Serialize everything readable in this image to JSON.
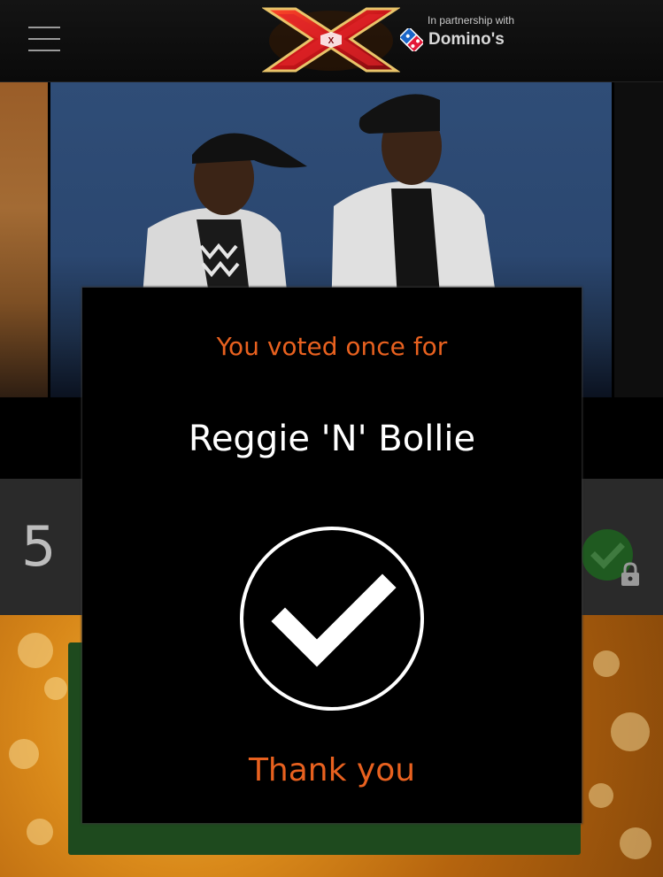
{
  "header": {
    "partner_label": "In partnership with",
    "partner_name": "Domino's",
    "logo_icon": "x-factor-logo",
    "menu_icon": "hamburger-menu-icon"
  },
  "contestant_row": {
    "rank": "5"
  },
  "modal": {
    "subtitle": "You voted once for",
    "name": "Reggie 'N' Bollie",
    "check_icon": "check-circle-icon",
    "thanks": "Thank you"
  },
  "colors": {
    "accent": "#e8611f",
    "text_primary": "#ffffff",
    "vote_green": "#1f5a20"
  }
}
